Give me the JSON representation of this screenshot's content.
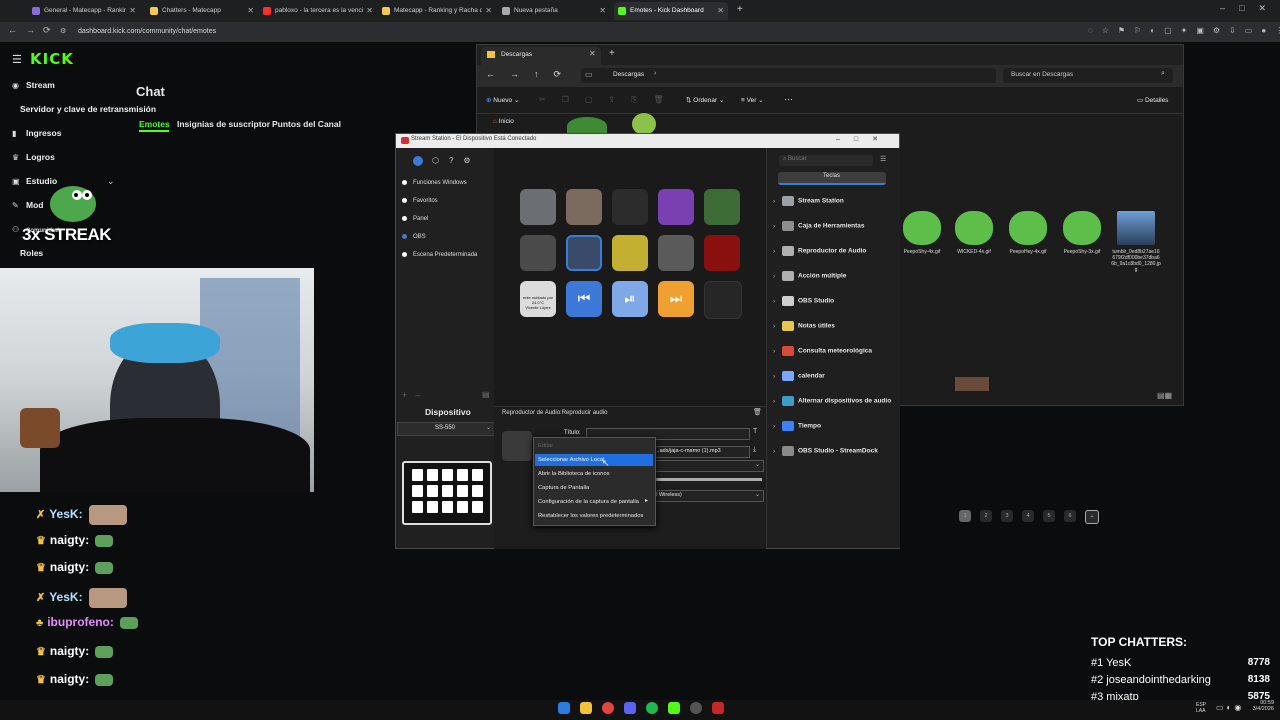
{
  "browser": {
    "tabs": [
      {
        "label": "General - Matecapp - Ranking",
        "color": "#8a6bd8"
      },
      {
        "label": "Chatters - Matecapp",
        "color": "#f7c948"
      },
      {
        "label": "pabloxo - la tercera es la vencida",
        "color": "#ff2d2d"
      },
      {
        "label": "Matecapp - Ranking y Racha de",
        "color": "#f7c948"
      },
      {
        "label": "Nueva pestaña",
        "color": "#aaaaaa"
      },
      {
        "label": "Emotes - Kick Dashboard",
        "color": "#53fc18"
      }
    ],
    "new_tab": "+",
    "url": "dashboard.kick.com/community/chat/emotes"
  },
  "kick": {
    "logo": "KICK",
    "sidebar": [
      {
        "label": "Stream",
        "icon": "radio-icon",
        "glyph": "◉"
      },
      {
        "label": "Servidor y clave de retransmisión",
        "icon": "",
        "glyph": ""
      },
      {
        "label": "Ingresos",
        "icon": "chart-icon",
        "glyph": "▮"
      },
      {
        "label": "Logros",
        "icon": "trophy-icon",
        "glyph": "♛"
      },
      {
        "label": "Estudio",
        "icon": "camera-icon",
        "glyph": "▣"
      },
      {
        "label": "Mod",
        "icon": "wrench-icon",
        "glyph": "✎"
      },
      {
        "label": "Comunidad",
        "icon": "people-icon",
        "glyph": "⚇"
      },
      {
        "label": "Roles",
        "icon": "",
        "glyph": ""
      }
    ],
    "page_title": "Chat",
    "tabs": [
      "Emotes",
      "Insignias de suscriptor",
      "Puntos del Canal"
    ],
    "overlay_streak": "3x STREAK"
  },
  "chat_lines": [
    {
      "user": "YesK:",
      "color": "#b2e3ff",
      "badge": "✗"
    },
    {
      "user": "naigty:",
      "color": "#ffffff",
      "badge": "♛"
    },
    {
      "user": "naigty:",
      "color": "#ffffff",
      "badge": "♛"
    },
    {
      "user": "YesK:",
      "color": "#b2e3ff",
      "badge": "✗"
    },
    {
      "user": "ibuprofeno:",
      "color": "#e68cff",
      "badge": "♣"
    },
    {
      "user": "naigty:",
      "color": "#ffffff",
      "badge": "♛"
    },
    {
      "user": "naigty:",
      "color": "#ffffff",
      "badge": "♛"
    },
    {
      "user": "naigty:",
      "color": "#ffffff",
      "badge": "♛"
    }
  ],
  "top_chatters": {
    "title": "TOP CHATTERS:",
    "entries": [
      {
        "rank": "#1 YesK",
        "score": "8778"
      },
      {
        "rank": "#2 joseandointhedarking",
        "score": "8138"
      },
      {
        "rank": "#3 mixatp",
        "score": "5875"
      }
    ]
  },
  "explorer": {
    "tab_title": "Descargas",
    "path": "Descargas",
    "search_placeholder": "Buscar en Descargas",
    "toolbar": {
      "new": "Nuevo",
      "sort": "Ordenar",
      "view": "Ver",
      "more": "⋯",
      "details": "Detalles"
    },
    "home": "Inicio",
    "files": [
      "PeepoShy-4x.gif",
      "WICKED-4x.gif",
      "PeepoHey-4x.gif",
      "PeepoShy-3x.gif",
      "tumblr_0ed8b27ae16679f2df000be37dba66b_9a1c8bd0_1280.jpg"
    ]
  },
  "streamstation": {
    "title": "Stream Station - El Dispositivo Está Conectado",
    "profiles": [
      "Funciones Windows",
      "Favoritos",
      "Panel",
      "OBS",
      "Escena Predeterminada"
    ],
    "active_profile": "OBS",
    "pages": [
      "1",
      "2",
      "3",
      "4",
      "5",
      "6",
      "+"
    ],
    "device_label": "Dispositivo",
    "device_model": "SS-550",
    "action_title": "Reproductor de Audio:Reproducir audio",
    "title_label": "Título:",
    "file_path": "...ads/jaja-c-mamo (1).mp3",
    "output_device": "ll Wireless)",
    "search_placeholder": "Buscar",
    "keys_tab": "Teclas",
    "key_photo_text": "ente nublado por\n24.0°C\nVicente López",
    "context_menu": [
      "Editar",
      "Seleccionar Archivo Local",
      "Abrir la Biblioteca de iconos",
      "Captura de Pantalla",
      "Configuración de la captura de pantalla",
      "Restablecer los valores predeterminados"
    ],
    "categories": [
      {
        "label": "Stream Station",
        "icon_color": "#9aa0a6"
      },
      {
        "label": "Caja de Herramientas",
        "icon_color": "#8e8e8e"
      },
      {
        "label": "Reproductor de Audio",
        "icon_color": "#b0b0b0"
      },
      {
        "label": "Acción múltiple",
        "icon_color": "#b0b0b0"
      },
      {
        "label": "OBS Studio",
        "icon_color": "#cfcfcf"
      },
      {
        "label": "Notas útiles",
        "icon_color": "#e6c74a"
      },
      {
        "label": "Consulta meteorológica",
        "icon_color": "#d84a3a"
      },
      {
        "label": "calendar",
        "icon_color": "#7aa7ff"
      },
      {
        "label": "Alternar dispositivos de audio",
        "icon_color": "#3aa0c8"
      },
      {
        "label": "Tiempo",
        "icon_color": "#3a82ff"
      },
      {
        "label": "OBS Studio - StreamDock",
        "icon_color": "#8a8a8a"
      }
    ]
  },
  "taskbar": {
    "lang": "ESP\nLAA",
    "time": "00:59",
    "date": "3/4/2026"
  }
}
